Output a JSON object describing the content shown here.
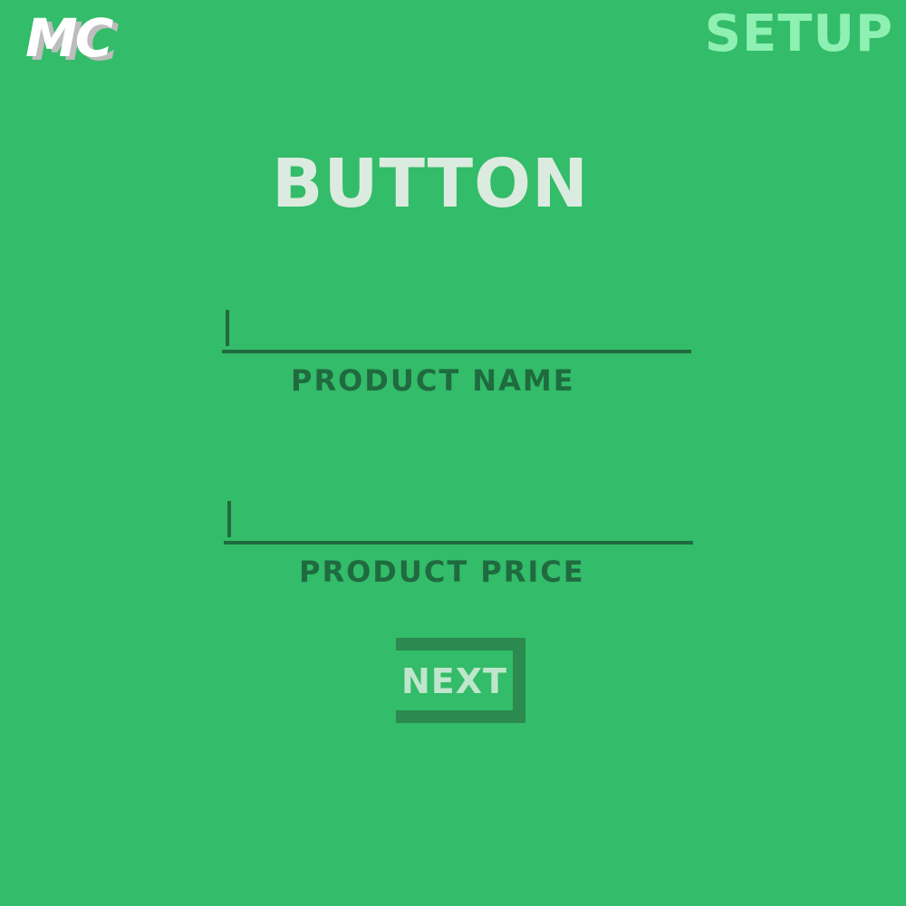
{
  "header": {
    "logo_text": "MC",
    "screen_title": "SETUP"
  },
  "main": {
    "heading": "BUTTON",
    "fields": [
      {
        "label": "PRODUCT NAME",
        "value": ""
      },
      {
        "label": "PRODUCT PRICE",
        "value": ""
      }
    ],
    "next_label": "NEXT"
  },
  "colors": {
    "background": "#33bc69",
    "title_accent": "#8ef0b2",
    "heading": "#dcebdf",
    "field_ink": "#1f6b3f",
    "button_frame": "#2a8a4f",
    "button_text": "#bfe6cc"
  }
}
